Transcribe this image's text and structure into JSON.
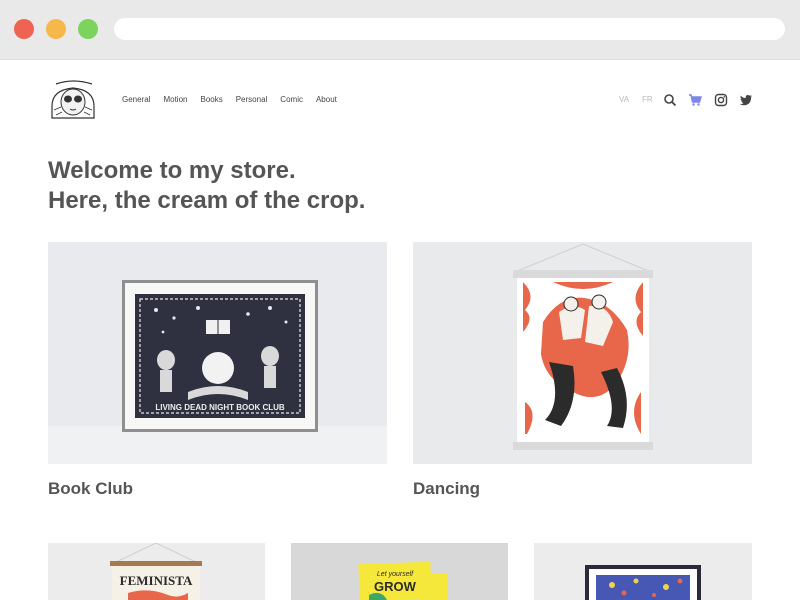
{
  "browser": {
    "url": ""
  },
  "nav": {
    "items": [
      "General",
      "Motion",
      "Books",
      "Personal",
      "Comic",
      "About"
    ],
    "lang_va": "VA",
    "lang_fr": "FR",
    "icons": [
      "search-icon",
      "cart-icon",
      "instagram-icon",
      "twitter-icon"
    ],
    "cart_color": "#7b86e8"
  },
  "hero": {
    "line1": "Welcome to my store.",
    "line2": "Here, the cream of the crop."
  },
  "products": {
    "book_club": {
      "title": "Book Club",
      "print_text": "LIVING DEAD NIGHT BOOK CLUB"
    },
    "dancing": {
      "title": "Dancing"
    },
    "feminista": {
      "print_text": "FEMINISTA"
    },
    "grow": {
      "print_text_1": "Let yourself",
      "print_text_2": "GROW"
    },
    "framed": {}
  },
  "colors": {
    "accent_orange": "#e8664a",
    "accent_yellow": "#f5e83a"
  }
}
